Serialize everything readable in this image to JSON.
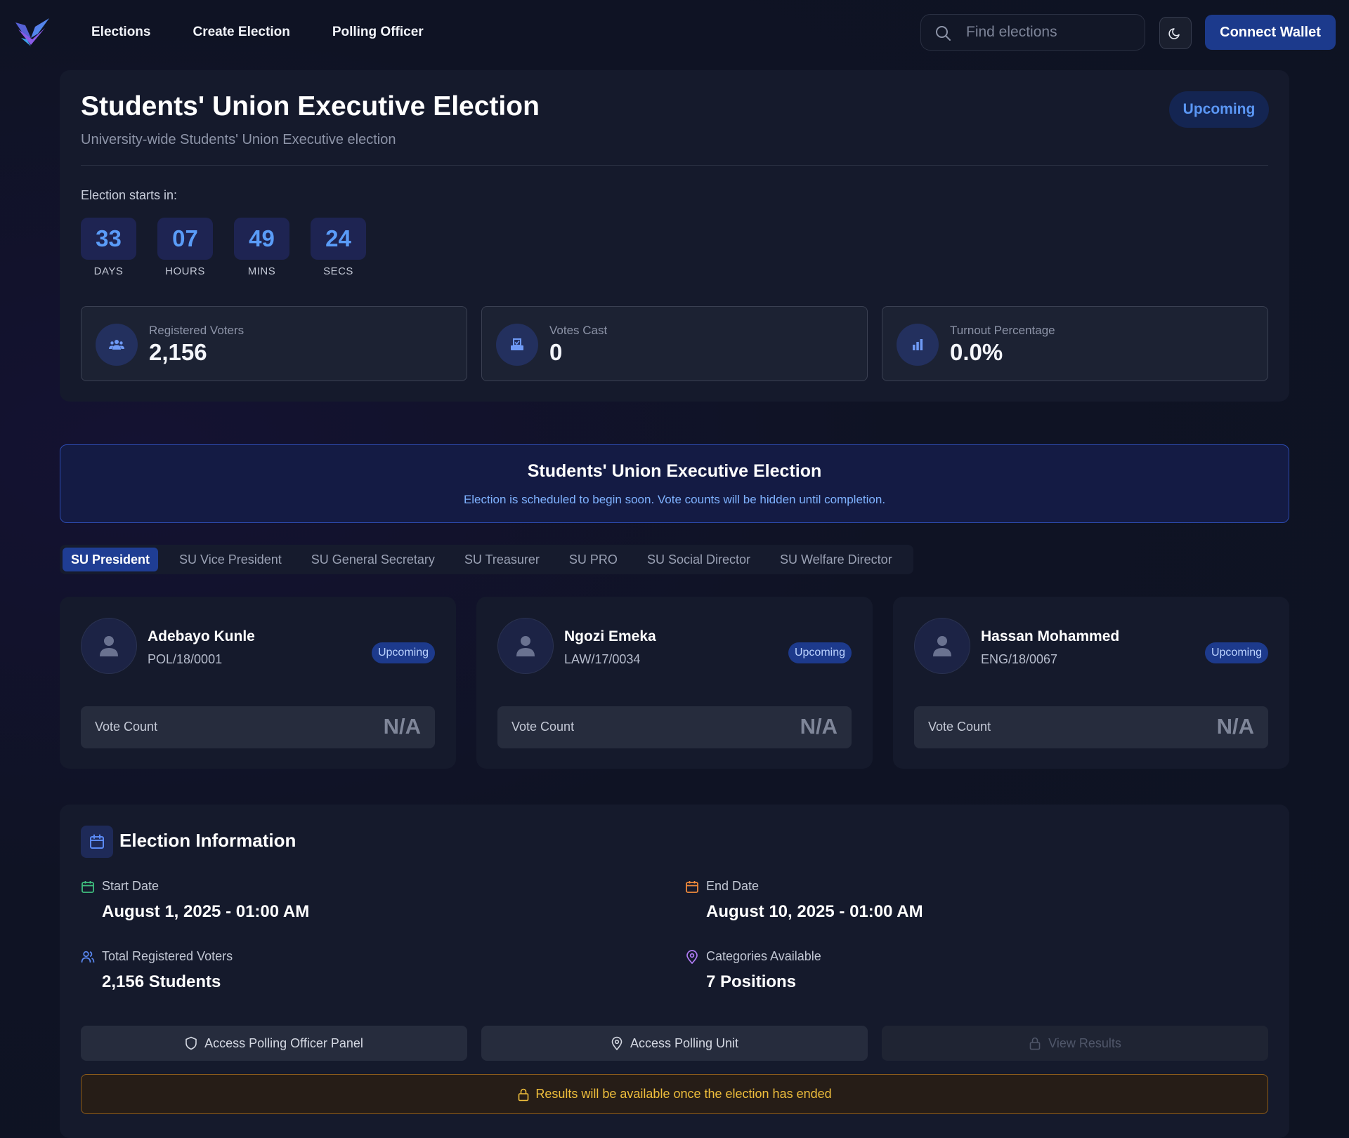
{
  "nav": {
    "links": [
      "Elections",
      "Create Election",
      "Polling Officer"
    ],
    "search_placeholder": "Find elections",
    "connect_label": "Connect Wallet",
    "theme_icon": "moon-icon"
  },
  "election": {
    "title": "Students' Union Executive Election",
    "subtitle": "University-wide Students' Union Executive election",
    "status": "Upcoming",
    "starts_label": "Election starts in:",
    "countdown": [
      {
        "value": "33",
        "unit": "DAYS"
      },
      {
        "value": "07",
        "unit": "HOURS"
      },
      {
        "value": "49",
        "unit": "MINS"
      },
      {
        "value": "24",
        "unit": "SECS"
      }
    ],
    "stats": [
      {
        "label": "Registered Voters",
        "value": "2,156",
        "icon": "users-icon"
      },
      {
        "label": "Votes Cast",
        "value": "0",
        "icon": "ballot-box-icon"
      },
      {
        "label": "Turnout Percentage",
        "value": "0.0%",
        "icon": "bar-chart-icon"
      }
    ]
  },
  "banner": {
    "title": "Students' Union Executive Election",
    "text": "Election is scheduled to begin soon. Vote counts will be hidden until completion."
  },
  "tabs": [
    "SU President",
    "SU Vice President",
    "SU General Secretary",
    "SU Treasurer",
    "SU PRO",
    "SU Social Director",
    "SU Welfare Director"
  ],
  "active_tab": "SU President",
  "candidates": [
    {
      "name": "Adebayo Kunle",
      "reg": "POL/18/0001",
      "badge": "Upcoming",
      "vote_label": "Vote Count",
      "vote_value": "N/A"
    },
    {
      "name": "Ngozi Emeka",
      "reg": "LAW/17/0034",
      "badge": "Upcoming",
      "vote_label": "Vote Count",
      "vote_value": "N/A"
    },
    {
      "name": "Hassan Mohammed",
      "reg": "ENG/18/0067",
      "badge": "Upcoming",
      "vote_label": "Vote Count",
      "vote_value": "N/A"
    }
  ],
  "info": {
    "title": "Election Information",
    "start": {
      "label": "Start Date",
      "value": "August 1, 2025 - 01:00 AM"
    },
    "end": {
      "label": "End Date",
      "value": "August 10, 2025 - 01:00 AM"
    },
    "voters": {
      "label": "Total Registered Voters",
      "value": "2,156 Students"
    },
    "categories": {
      "label": "Categories Available",
      "value": "7 Positions"
    },
    "actions": [
      "Access Polling Officer Panel",
      "Access Polling Unit",
      "View Results"
    ],
    "notice": "Results will be available once the election has ended"
  },
  "colors": {
    "accent": "#1c3a8c",
    "status_text": "#5b97f5",
    "countdown": "#5a9cf8",
    "notice": "#f0bf3c",
    "start_icon": "#3fbf7f",
    "end_icon": "#f08a3c",
    "voters_icon": "#5b8af5",
    "categories_icon": "#b07cf5"
  }
}
